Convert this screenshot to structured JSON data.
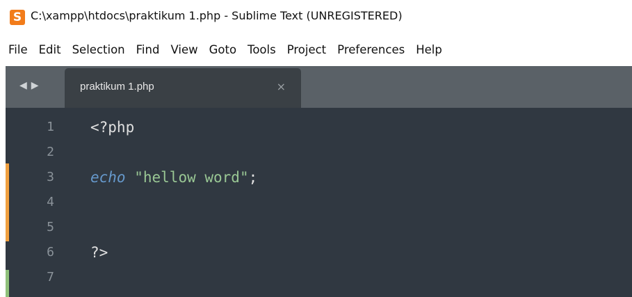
{
  "window": {
    "title": "C:\\xampp\\htdocs\\praktikum 1.php - Sublime Text (UNREGISTERED)",
    "app_icon_glyph": "S",
    "app_icon_name": "sublime-text-icon"
  },
  "menu": {
    "items": [
      "File",
      "Edit",
      "Selection",
      "Find",
      "View",
      "Goto",
      "Tools",
      "Project",
      "Preferences",
      "Help"
    ]
  },
  "tabs": {
    "nav_arrows": [
      "◀",
      "▶"
    ],
    "active_tab": {
      "label": "praktikum 1.php",
      "close_glyph": "×"
    }
  },
  "editor": {
    "lines": [
      {
        "number": "1",
        "code": "<?php"
      },
      {
        "number": "2",
        "code": ""
      },
      {
        "number": "3",
        "keyword": "echo",
        "string": "\"hellow word\"",
        "terminator": ";"
      },
      {
        "number": "4",
        "code": ""
      },
      {
        "number": "5",
        "code": ""
      },
      {
        "number": "6",
        "code": "?>"
      },
      {
        "number": "7",
        "code": ""
      }
    ],
    "gutter_marks": [
      {
        "kind": "modified",
        "color": "#f0a040"
      },
      {
        "kind": "added",
        "color": "#8fc07a"
      }
    ]
  },
  "colors": {
    "editor_bg": "#303841",
    "tabstrip_bg": "#5a6167",
    "active_tab_bg": "#3a4045",
    "keyword": "#6699cc",
    "string": "#99c794",
    "line_number": "#8a9299"
  }
}
